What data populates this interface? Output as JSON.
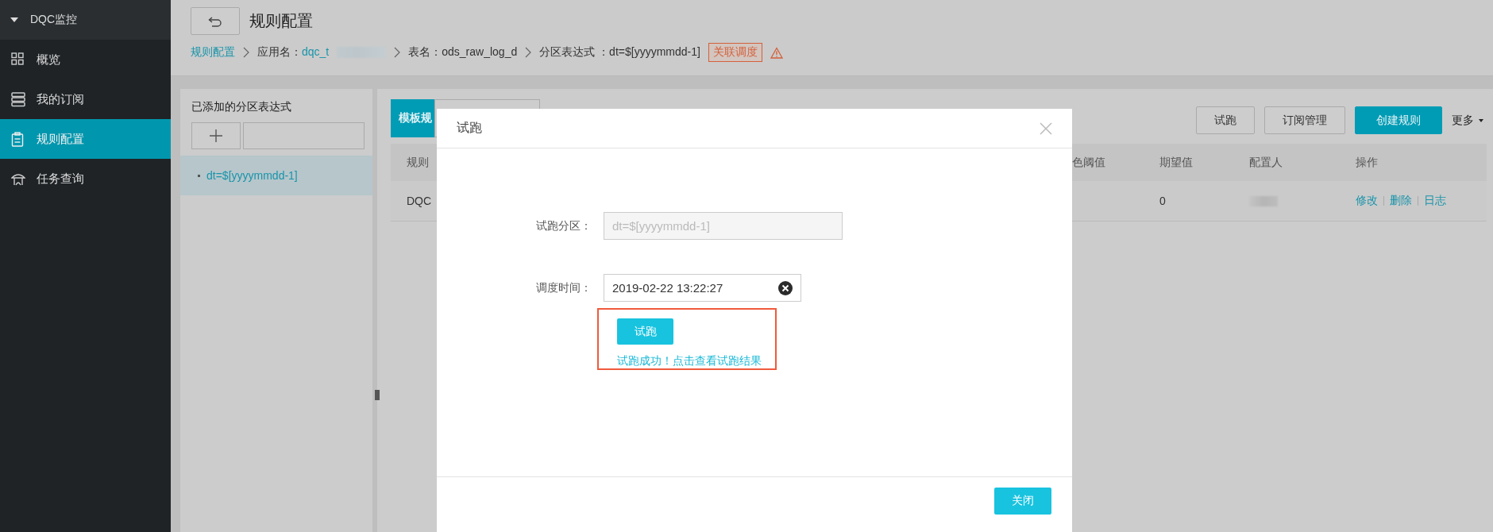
{
  "sidebar": {
    "header": {
      "label": "DQC监控",
      "expanded": true
    },
    "items": [
      {
        "label": "概览",
        "kind": "grid",
        "selected": false
      },
      {
        "label": "我的订阅",
        "kind": "stack",
        "selected": false
      },
      {
        "label": "规则配置",
        "kind": "clipboard",
        "selected": true
      },
      {
        "label": "任务查询",
        "kind": "pavilion",
        "selected": false
      }
    ]
  },
  "header": {
    "title": "规则配置",
    "breadcrumb": [
      {
        "kind": "link",
        "text": "规则配置"
      },
      {
        "kind": "app",
        "label": "应用名：",
        "value": "dqc_t",
        "redacted": true
      },
      {
        "kind": "text",
        "text": "表名：ods_raw_log_d"
      },
      {
        "kind": "text",
        "text": "分区表达式 ：dt=$[yyyymmdd-1]"
      }
    ],
    "badge": "关联调度",
    "warning": true
  },
  "partition_panel": {
    "title": "已添加的分区表达式",
    "items": [
      {
        "text": "dt=$[yyyymmdd-1]",
        "selected": true
      }
    ]
  },
  "rules": {
    "tabs": [
      {
        "label": "模板规",
        "selected": true
      },
      {
        "selected": false
      }
    ],
    "buttons": [
      {
        "label": "试跑",
        "kind": "default"
      },
      {
        "label": "订阅管理",
        "kind": "default"
      },
      {
        "label": "创建规则",
        "kind": "primary"
      }
    ],
    "more": "更多",
    "table": {
      "columns": [
        "规则",
        "色阈值",
        "期望值",
        "配置人",
        "操作"
      ],
      "rows": [
        {
          "rule": "DQC",
          "expected": "0",
          "configurer_redacted": true,
          "actions": [
            "修改",
            "删除",
            "日志"
          ]
        }
      ]
    }
  },
  "dialog": {
    "title": "试跑",
    "fields": [
      {
        "label": "试跑分区：",
        "value": "dt=$[yyyymmdd-1]",
        "disabled": true,
        "clearable": false
      },
      {
        "label": "调度时间：",
        "value": "2019-02-22 13:22:27",
        "disabled": false,
        "clearable": true
      }
    ],
    "run_button": "试跑",
    "result_link": "试跑成功！点击查看试跑结果",
    "highlighted": true,
    "close_button": "关闭"
  }
}
